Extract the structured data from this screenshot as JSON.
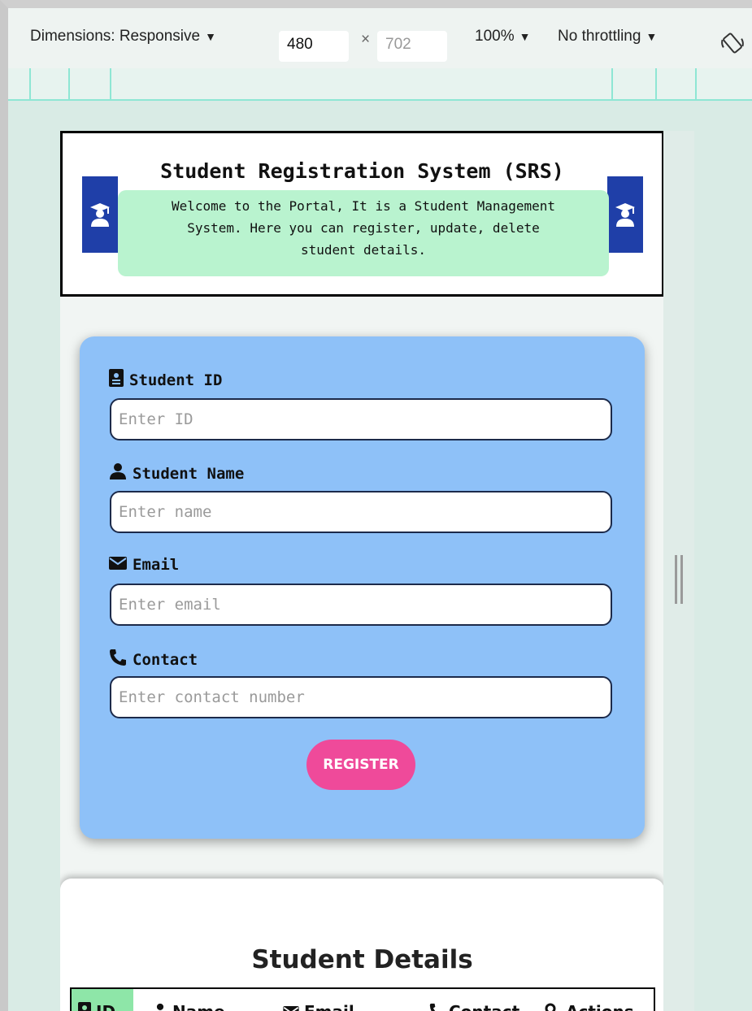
{
  "devtools": {
    "dimensions_label": "Dimensions: Responsive",
    "width_value": "480",
    "times_symbol": "×",
    "height_value": "702",
    "zoom_label": "100%",
    "throttling_label": "No throttling"
  },
  "header": {
    "title": "Student Registration System (SRS)",
    "welcome_line1": "Welcome to the Portal, It is a Student Management",
    "welcome_line2": "System. Here you can register, update, delete",
    "welcome_line3": "student details."
  },
  "form": {
    "student_id": {
      "label": "Student ID",
      "placeholder": "Enter ID"
    },
    "student_name": {
      "label": "Student Name",
      "placeholder": "Enter name"
    },
    "email": {
      "label": "Email",
      "placeholder": "Enter email"
    },
    "contact": {
      "label": "Contact",
      "placeholder": "Enter contact number"
    },
    "register_label": "REGISTER"
  },
  "details": {
    "title": "Student Details",
    "columns": [
      "ID",
      "Name",
      "Email",
      "Contact",
      "Actions"
    ]
  },
  "colors": {
    "header_badge": "#1f3fa8",
    "welcome_bg": "#b9f3cf",
    "form_bg": "#8ec1f8",
    "register_button": "#ef4a9a",
    "id_header_bg": "#8ee6a8"
  }
}
